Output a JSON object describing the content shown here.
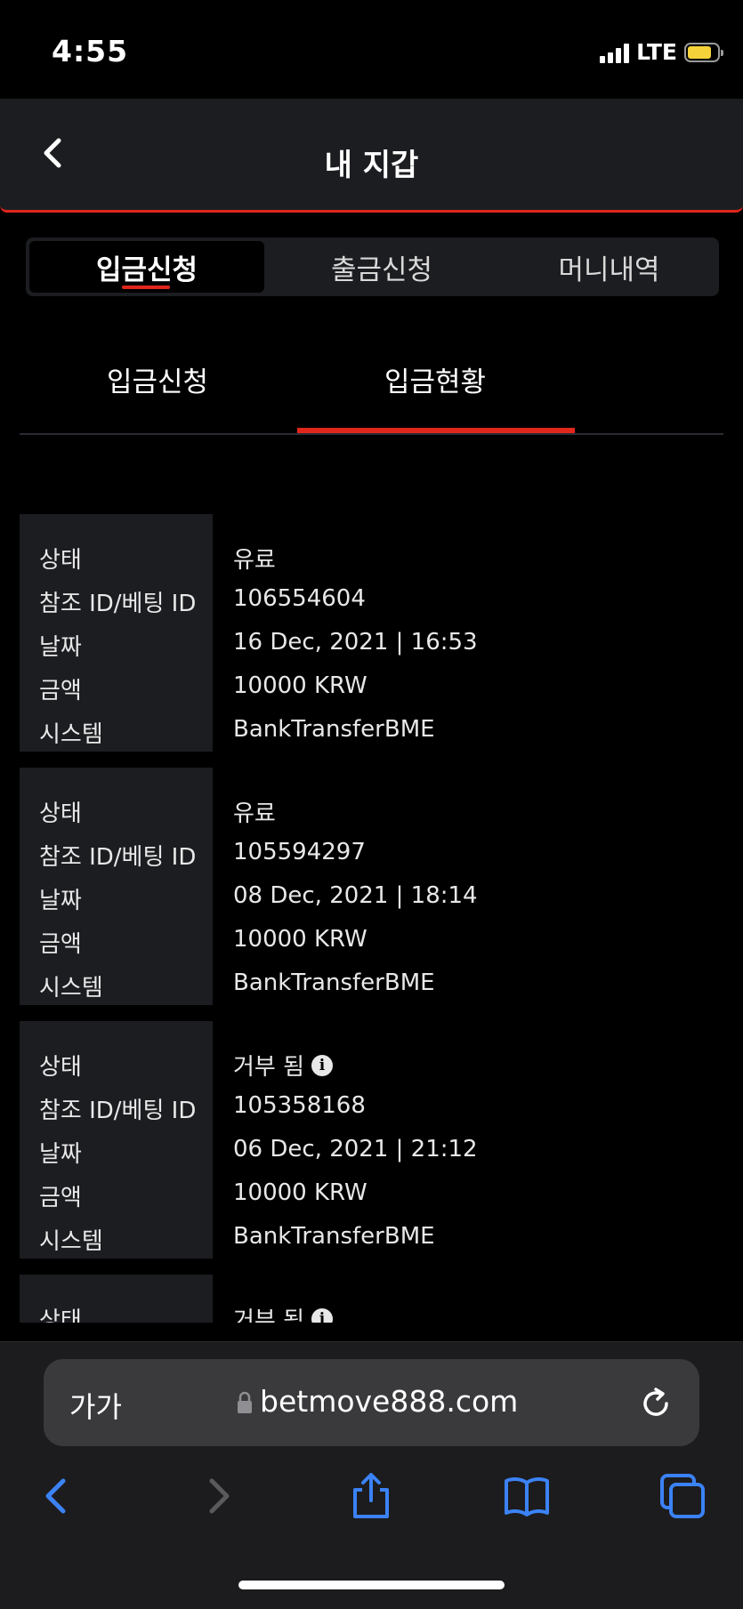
{
  "status_bar": {
    "time": "4:55",
    "network": "LTE"
  },
  "header": {
    "title": "내 지갑"
  },
  "segments": [
    {
      "label": "입금신청"
    },
    {
      "label": "출금신청"
    },
    {
      "label": "머니내역"
    }
  ],
  "subtabs": [
    {
      "label": "입금신청"
    },
    {
      "label": "입금현황"
    }
  ],
  "labels": {
    "status": "상태",
    "ref_id": "참조 ID/베팅 ID",
    "date": "날짜",
    "amount": "금액",
    "system": "시스템"
  },
  "records": [
    {
      "status": "유료",
      "ref_id": "106554604",
      "date": "16 Dec, 2021 | 16:53",
      "amount": "10000 KRW",
      "system": "BankTransferBME"
    },
    {
      "status": "유료",
      "ref_id": "105594297",
      "date": "08 Dec, 2021 | 18:14",
      "amount": "10000 KRW",
      "system": "BankTransferBME"
    },
    {
      "status": "거부 됨",
      "ref_id": "105358168",
      "date": "06 Dec, 2021 | 21:12",
      "amount": "10000 KRW",
      "system": "BankTransferBME"
    },
    {
      "status": "거부 됨"
    }
  ],
  "browser": {
    "text_size": "가가",
    "url": "betmove888.com"
  },
  "colors": {
    "accent": "#e1261c",
    "panel": "#1c1d21",
    "ios_blue": "#3b82f6"
  }
}
